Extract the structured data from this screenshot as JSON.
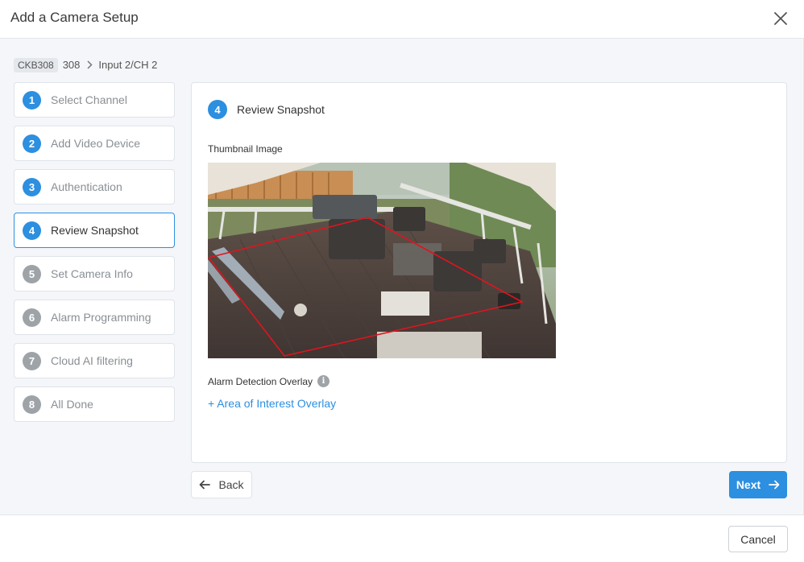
{
  "dialog": {
    "title": "Add a Camera Setup"
  },
  "breadcrumb": {
    "chip": "CKB308",
    "panel": "308",
    "input": "Input 2/CH 2"
  },
  "steps": [
    {
      "num": "1",
      "label": "Select Channel",
      "state": "done"
    },
    {
      "num": "2",
      "label": "Add Video Device",
      "state": "done"
    },
    {
      "num": "3",
      "label": "Authentication",
      "state": "done"
    },
    {
      "num": "4",
      "label": "Review Snapshot",
      "state": "active"
    },
    {
      "num": "5",
      "label": "Set Camera Info",
      "state": "todo"
    },
    {
      "num": "6",
      "label": "Alarm Programming",
      "state": "todo"
    },
    {
      "num": "7",
      "label": "Cloud AI filtering",
      "state": "todo"
    },
    {
      "num": "8",
      "label": "All Done",
      "state": "todo"
    }
  ],
  "panel": {
    "step_num": "4",
    "title": "Review Snapshot",
    "thumbnail_label": "Thumbnail Image",
    "overlay_label": "Alarm Detection Overlay",
    "info_glyph": "i",
    "aoi_link": "+ Area of Interest Overlay"
  },
  "nav": {
    "back_label": "Back",
    "next_label": "Next"
  },
  "footer": {
    "cancel_label": "Cancel"
  },
  "colors": {
    "accent": "#2c8fe0",
    "inactive_step": "#9ea3a8",
    "overlay_line": "#e0141e"
  },
  "icons": {
    "close": "close-icon",
    "breadcrumb_sep": "chevron-right-icon",
    "back": "arrow-left-icon",
    "next": "arrow-right-icon",
    "info": "info-icon"
  }
}
